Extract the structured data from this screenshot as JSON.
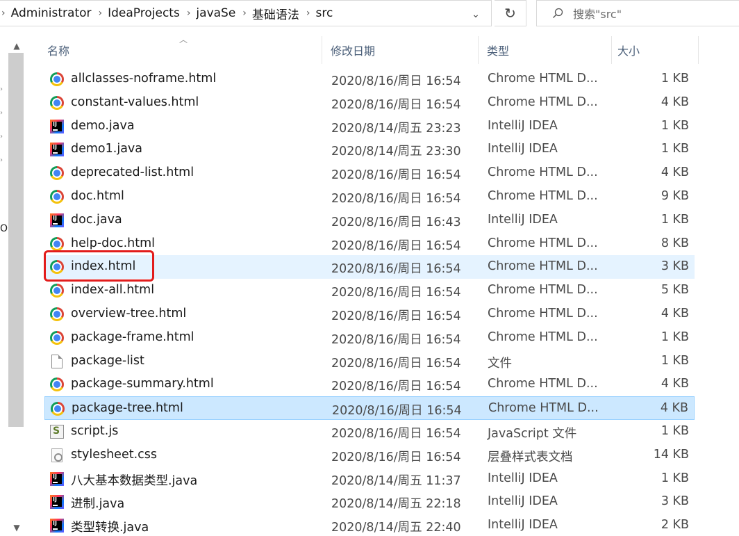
{
  "address_bar": {
    "breadcrumbs": [
      "Administrator",
      "IdeaProjects",
      "javaSe",
      "基础语法",
      "src"
    ]
  },
  "search": {
    "placeholder": "搜索\"src\""
  },
  "nav": {
    "partial_label": "O"
  },
  "columns": {
    "name": "名称",
    "date": "修改日期",
    "type": "类型",
    "size": "大小"
  },
  "files": [
    {
      "name": "allclasses-noframe.html",
      "date": "2020/8/16/周日 16:54",
      "type": "Chrome HTML D...",
      "size": "1 KB",
      "icon": "chrome-icon"
    },
    {
      "name": "constant-values.html",
      "date": "2020/8/16/周日 16:54",
      "type": "Chrome HTML D...",
      "size": "4 KB",
      "icon": "chrome-icon"
    },
    {
      "name": "demo.java",
      "date": "2020/8/14/周五 23:23",
      "type": "IntelliJ IDEA",
      "size": "1 KB",
      "icon": "intellij-icon"
    },
    {
      "name": "demo1.java",
      "date": "2020/8/14/周五 23:30",
      "type": "IntelliJ IDEA",
      "size": "1 KB",
      "icon": "intellij-icon"
    },
    {
      "name": "deprecated-list.html",
      "date": "2020/8/16/周日 16:54",
      "type": "Chrome HTML D...",
      "size": "4 KB",
      "icon": "chrome-icon"
    },
    {
      "name": "doc.html",
      "date": "2020/8/16/周日 16:54",
      "type": "Chrome HTML D...",
      "size": "9 KB",
      "icon": "chrome-icon"
    },
    {
      "name": "doc.java",
      "date": "2020/8/16/周日 16:43",
      "type": "IntelliJ IDEA",
      "size": "1 KB",
      "icon": "intellij-icon"
    },
    {
      "name": "help-doc.html",
      "date": "2020/8/16/周日 16:54",
      "type": "Chrome HTML D...",
      "size": "8 KB",
      "icon": "chrome-icon"
    },
    {
      "name": "index.html",
      "date": "2020/8/16/周日 16:54",
      "type": "Chrome HTML D...",
      "size": "3 KB",
      "icon": "chrome-icon",
      "state": "hover"
    },
    {
      "name": "index-all.html",
      "date": "2020/8/16/周日 16:54",
      "type": "Chrome HTML D...",
      "size": "5 KB",
      "icon": "chrome-icon"
    },
    {
      "name": "overview-tree.html",
      "date": "2020/8/16/周日 16:54",
      "type": "Chrome HTML D...",
      "size": "4 KB",
      "icon": "chrome-icon"
    },
    {
      "name": "package-frame.html",
      "date": "2020/8/16/周日 16:54",
      "type": "Chrome HTML D...",
      "size": "1 KB",
      "icon": "chrome-icon"
    },
    {
      "name": "package-list",
      "date": "2020/8/16/周日 16:54",
      "type": "文件",
      "size": "1 KB",
      "icon": "blank-file-icon"
    },
    {
      "name": "package-summary.html",
      "date": "2020/8/16/周日 16:54",
      "type": "Chrome HTML D...",
      "size": "4 KB",
      "icon": "chrome-icon"
    },
    {
      "name": "package-tree.html",
      "date": "2020/8/16/周日 16:54",
      "type": "Chrome HTML D...",
      "size": "4 KB",
      "icon": "chrome-icon",
      "state": "selected"
    },
    {
      "name": "script.js",
      "date": "2020/8/16/周日 16:54",
      "type": "JavaScript 文件",
      "size": "1 KB",
      "icon": "javascript-file-icon"
    },
    {
      "name": "stylesheet.css",
      "date": "2020/8/16/周日 16:54",
      "type": "层叠样式表文档",
      "size": "14 KB",
      "icon": "css-file-icon"
    },
    {
      "name": "八大基本数据类型.java",
      "date": "2020/8/14/周五 11:37",
      "type": "IntelliJ IDEA",
      "size": "1 KB",
      "icon": "intellij-icon"
    },
    {
      "name": "进制.java",
      "date": "2020/8/14/周五 22:18",
      "type": "IntelliJ IDEA",
      "size": "3 KB",
      "icon": "intellij-icon"
    },
    {
      "name": "类型转换.java",
      "date": "2020/8/14/周五 22:40",
      "type": "IntelliJ IDEA",
      "size": "2 KB",
      "icon": "intellij-icon"
    }
  ],
  "colors": {
    "hover": "#e5f3ff",
    "selected": "#cce8ff",
    "highlight_box": "#e21c1c"
  }
}
